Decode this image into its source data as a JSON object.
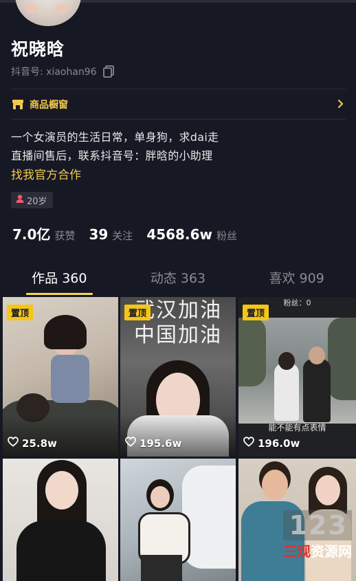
{
  "profile": {
    "name": "祝晓晗",
    "douyin_id": "抖音号: xiaohan96",
    "shop_label": "商品橱窗",
    "bio_line1": "一个女演员的生活日常，单身狗，求dai走",
    "bio_line2": "直播间售后，联系抖音号：胖晗的小助理",
    "collab_link": "找我官方合作",
    "age_tag": "20岁"
  },
  "stats": [
    {
      "value": "7.0亿",
      "label": "获赞"
    },
    {
      "value": "39",
      "label": "关注"
    },
    {
      "value": "4568.6w",
      "label": "粉丝"
    }
  ],
  "tabs": [
    {
      "label": "作品 360",
      "active": true
    },
    {
      "label": "动态 363",
      "active": false
    },
    {
      "label": "喜欢 909",
      "active": false
    }
  ],
  "videos": [
    {
      "pinned": "置顶",
      "likes": "25.8w"
    },
    {
      "pinned": "置顶",
      "likes": "195.6w",
      "overlay_text": "武汉加油\n中国加油"
    },
    {
      "pinned": "置顶",
      "likes": "196.0w",
      "top_text": "粉丝：0",
      "caption": "能不能有点表情"
    },
    {},
    {},
    {}
  ],
  "watermark": {
    "number": "123",
    "text_red": "三观",
    "text_white": "资源网"
  },
  "colors": {
    "background": "#161823",
    "accent_yellow": "#f2c94c",
    "tab_underline": "#f5d84a",
    "pin_badge": "#f5c518"
  },
  "icons": [
    "copy-icon",
    "shop-icon",
    "chevron-right-icon",
    "gender-female-icon",
    "heart-icon"
  ]
}
